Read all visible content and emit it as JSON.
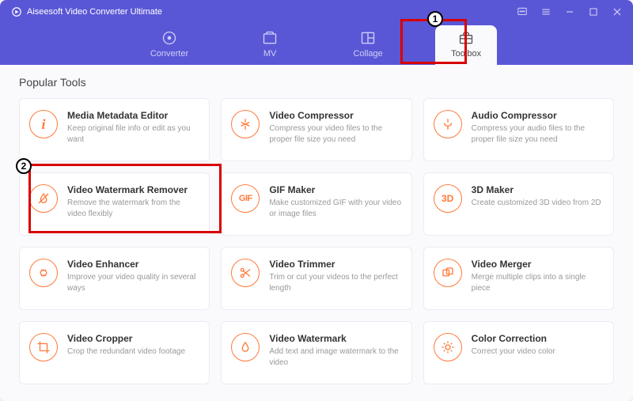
{
  "app": {
    "title": "Aiseesoft Video Converter Ultimate"
  },
  "nav": {
    "items": [
      {
        "label": "Converter",
        "icon": "converter-icon"
      },
      {
        "label": "MV",
        "icon": "mv-icon"
      },
      {
        "label": "Collage",
        "icon": "collage-icon"
      },
      {
        "label": "Toolbox",
        "icon": "toolbox-icon"
      }
    ]
  },
  "section": {
    "title": "Popular Tools"
  },
  "tools": [
    {
      "title": "Media Metadata Editor",
      "desc": "Keep original file info or edit as you want",
      "icon": "i"
    },
    {
      "title": "Video Compressor",
      "desc": "Compress your video files to the proper file size you need",
      "icon": "compress"
    },
    {
      "title": "Audio Compressor",
      "desc": "Compress your audio files to the proper file size you need",
      "icon": "audio-compress"
    },
    {
      "title": "Video Watermark Remover",
      "desc": "Remove the watermark from the video flexibly",
      "icon": "no-drop"
    },
    {
      "title": "GIF Maker",
      "desc": "Make customized GIF with your video or image files",
      "icon": "GIF"
    },
    {
      "title": "3D Maker",
      "desc": "Create customized 3D video from 2D",
      "icon": "3D"
    },
    {
      "title": "Video Enhancer",
      "desc": "Improve your video quality in several ways",
      "icon": "enhance"
    },
    {
      "title": "Video Trimmer",
      "desc": "Trim or cut your videos to the perfect length",
      "icon": "scissors"
    },
    {
      "title": "Video Merger",
      "desc": "Merge multiple clips into a single piece",
      "icon": "merge"
    },
    {
      "title": "Video Cropper",
      "desc": "Crop the redundant video footage",
      "icon": "crop"
    },
    {
      "title": "Video Watermark",
      "desc": "Add text and image watermark to the video",
      "icon": "drop"
    },
    {
      "title": "Color Correction",
      "desc": "Correct your video color",
      "icon": "sun"
    }
  ],
  "annotations": {
    "1": "1",
    "2": "2"
  }
}
